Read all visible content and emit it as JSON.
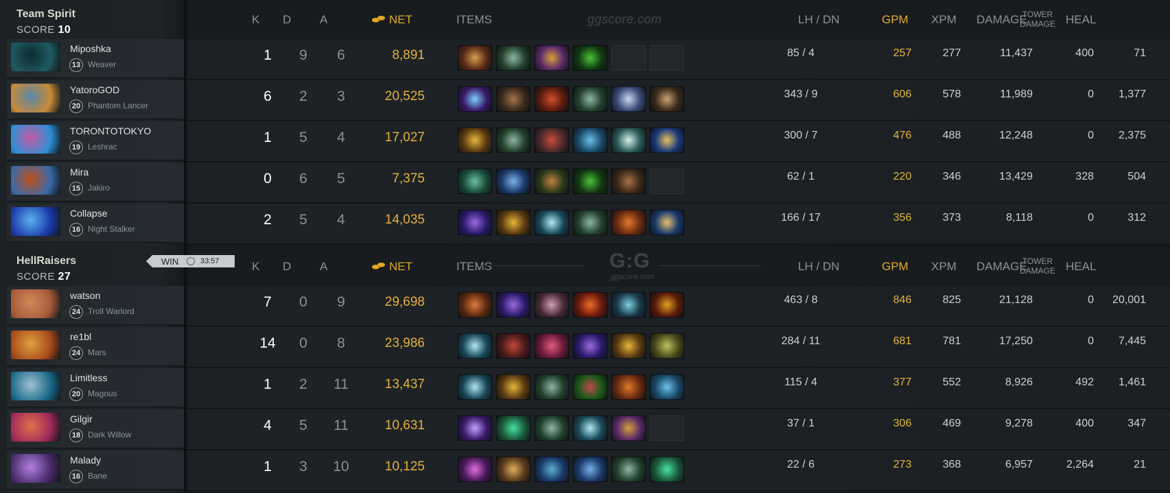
{
  "teams": [
    {
      "name": "Team Spirit",
      "score_label": "SCORE",
      "score": "10",
      "players": [
        {
          "name": "Miposhka",
          "level": "13",
          "hero": "Weaver",
          "k": "1",
          "d": "9",
          "a": "6",
          "net": "8,891",
          "lhdn": "85  /  4",
          "gpm": "257",
          "xpm": "277",
          "damage": "11,437",
          "heal": "400",
          "tower": "71",
          "portrait": [
            "#1f5a62",
            "#0d2a30"
          ],
          "items": [
            [
              "#5b2a18",
              "#d4a04a"
            ],
            [
              "#22412c",
              "#8fb5a2"
            ],
            [
              "#5a2a6a",
              "#d8a03a"
            ],
            [
              "#123a12",
              "#4cc23a"
            ],
            null,
            null
          ]
        },
        {
          "name": "YatoroGOD",
          "level": "20",
          "hero": "Phantom Lancer",
          "k": "6",
          "d": "2",
          "a": "3",
          "net": "20,525",
          "lhdn": "343  /  9",
          "gpm": "606",
          "xpm": "578",
          "damage": "11,989",
          "heal": "0",
          "tower": "1,377",
          "portrait": [
            "#c78a3a",
            "#5a88a8"
          ],
          "items": [
            [
              "#3a1a6a",
              "#7ad0ff"
            ],
            [
              "#3a2a1c",
              "#a27448"
            ],
            [
              "#5a1a10",
              "#d0502a"
            ],
            [
              "#22412c",
              "#8fb5a2"
            ],
            [
              "#3a4a7a",
              "#c9d8f0"
            ],
            [
              "#3a2a1a",
              "#c9a070"
            ]
          ]
        },
        {
          "name": "TORONTOTOKYO",
          "level": "19",
          "hero": "Leshrac",
          "k": "1",
          "d": "5",
          "a": "4",
          "net": "17,027",
          "lhdn": "300  /  7",
          "gpm": "476",
          "xpm": "488",
          "damage": "12,248",
          "heal": "0",
          "tower": "2,375",
          "portrait": [
            "#2e8fd6",
            "#c65aa2"
          ],
          "items": [
            [
              "#5a3a10",
              "#e6b53a"
            ],
            [
              "#22412c",
              "#8fb5a2"
            ],
            [
              "#4a2a2a",
              "#c94a3a"
            ],
            [
              "#1a4a6a",
              "#6ac0e8"
            ],
            [
              "#2a5a5a",
              "#d6f0e8"
            ],
            [
              "#1a3a7a",
              "#e8c060"
            ]
          ]
        },
        {
          "name": "Mira",
          "level": "15",
          "hero": "Jakiro",
          "k": "0",
          "d": "6",
          "a": "5",
          "net": "7,375",
          "lhdn": "62  /  1",
          "gpm": "220",
          "xpm": "346",
          "damage": "13,429",
          "heal": "328",
          "tower": "504",
          "portrait": [
            "#3a6aa8",
            "#c0501a"
          ],
          "items": [
            [
              "#1a4a3a",
              "#6ac0a0"
            ],
            [
              "#1a3a6a",
              "#7ab0e8"
            ],
            [
              "#2a3a1a",
              "#c08040"
            ],
            [
              "#123a12",
              "#4cc23a"
            ],
            [
              "#3a2818",
              "#a87048"
            ],
            null
          ]
        },
        {
          "name": "Collapse",
          "level": "16",
          "hero": "Night Stalker",
          "k": "2",
          "d": "5",
          "a": "4",
          "net": "14,035",
          "lhdn": "166  /  17",
          "gpm": "356",
          "xpm": "373",
          "damage": "8,118",
          "heal": "0",
          "tower": "312",
          "portrait": [
            "#1a3aa8",
            "#5ab0f0"
          ],
          "items": [
            [
              "#2a1a6a",
              "#9a6ae0"
            ],
            [
              "#5a3a10",
              "#e6b53a"
            ],
            [
              "#1a4a5a",
              "#b0e8f0"
            ],
            [
              "#22412c",
              "#8fb5a2"
            ],
            [
              "#6a2a10",
              "#e07a2a"
            ],
            [
              "#1a3a6a",
              "#e8c070"
            ]
          ]
        }
      ]
    },
    {
      "name": "HellRaisers",
      "score_label": "SCORE",
      "score": "27",
      "players": [
        {
          "name": "watson",
          "level": "24",
          "hero": "Troll Warlord",
          "k": "7",
          "d": "0",
          "a": "9",
          "net": "29,698",
          "lhdn": "463  /  8",
          "gpm": "846",
          "xpm": "825",
          "damage": "21,128",
          "heal": "0",
          "tower": "20,001",
          "portrait": [
            "#a85a3a",
            "#d08a5a"
          ],
          "items": [
            [
              "#5a2a10",
              "#e07a3a"
            ],
            [
              "#2a1a6a",
              "#9a6ae0"
            ],
            [
              "#4a2a3a",
              "#d0a0b0"
            ],
            [
              "#6a1a0a",
              "#f06a2a"
            ],
            [
              "#1a3a4a",
              "#7ad0e0"
            ],
            [
              "#5a1a0a",
              "#e0a020"
            ]
          ]
        },
        {
          "name": "re1bl",
          "level": "24",
          "hero": "Mars",
          "k": "14",
          "d": "0",
          "a": "8",
          "net": "23,986",
          "lhdn": "284  /  11",
          "gpm": "681",
          "xpm": "781",
          "damage": "17,250",
          "heal": "0",
          "tower": "7,445",
          "portrait": [
            "#a84a1a",
            "#e0a040"
          ],
          "items": [
            [
              "#1a4a5a",
              "#b0e8f0"
            ],
            [
              "#4a1a1a",
              "#c04a3a"
            ],
            [
              "#6a1a3a",
              "#e05a7a"
            ],
            [
              "#2a1a6a",
              "#9a6ae0"
            ],
            [
              "#5a3a10",
              "#e6b53a"
            ],
            [
              "#4a4a1a",
              "#c0c060"
            ]
          ]
        },
        {
          "name": "Limitless",
          "level": "20",
          "hero": "Magnus",
          "k": "1",
          "d": "2",
          "a": "11",
          "net": "13,437",
          "lhdn": "115  /  4",
          "gpm": "377",
          "xpm": "552",
          "damage": "8,926",
          "heal": "492",
          "tower": "1,461",
          "portrait": [
            "#1a6a8a",
            "#a0c0d0"
          ],
          "items": [
            [
              "#1a4a5a",
              "#b0e8f0"
            ],
            [
              "#5a3a10",
              "#e6b53a"
            ],
            [
              "#22412c",
              "#8fb5a2"
            ],
            [
              "#1a5a1a",
              "#c04a4a"
            ],
            [
              "#6a2a10",
              "#e07a2a"
            ],
            [
              "#1a4a6a",
              "#6ac0e8"
            ]
          ]
        },
        {
          "name": "Gilgir",
          "level": "18",
          "hero": "Dark Willow",
          "k": "4",
          "d": "5",
          "a": "11",
          "net": "10,631",
          "lhdn": "37  /  1",
          "gpm": "306",
          "xpm": "469",
          "damage": "9,278",
          "heal": "400",
          "tower": "347",
          "portrait": [
            "#a02a5a",
            "#e0704a"
          ],
          "items": [
            [
              "#3a1a6a",
              "#c0a0ff"
            ],
            [
              "#1a5a3a",
              "#4ae0a0"
            ],
            [
              "#22412c",
              "#8fb5a2"
            ],
            [
              "#1a4a5a",
              "#b0e8f0"
            ],
            [
              "#5a2a6a",
              "#d8a03a"
            ],
            null
          ]
        },
        {
          "name": "Malady",
          "level": "16",
          "hero": "Bane",
          "k": "1",
          "d": "3",
          "a": "10",
          "net": "10,125",
          "lhdn": "22  /  6",
          "gpm": "273",
          "xpm": "368",
          "damage": "6,957",
          "heal": "2,264",
          "tower": "21",
          "portrait": [
            "#4a2a6a",
            "#b080e0"
          ],
          "items": [
            [
              "#4a1a5a",
              "#e06ae0"
            ],
            [
              "#5a3a1a",
              "#e0b060"
            ],
            [
              "#1a3a6a",
              "#5ab0d0"
            ],
            [
              "#1a3a6a",
              "#7ab0e8"
            ],
            [
              "#22412c",
              "#8fb5a2"
            ],
            [
              "#1a5a3a",
              "#4ae0a0"
            ]
          ]
        }
      ]
    }
  ],
  "result": {
    "label": "WIN",
    "time": "33:57"
  },
  "columns": {
    "k": "K",
    "d": "D",
    "a": "A",
    "net": "NET",
    "items": "ITEMS",
    "lhdn": "LH  /  DN",
    "gpm": "GPM",
    "xpm": "XPM",
    "damage": "DAMAGE",
    "heal": "HEAL",
    "tower_line1": "TOWER",
    "tower_line2": "DAMAGE"
  },
  "watermark": "ggscore.com",
  "logo": {
    "mark": "G:G",
    "sub": "ggscore.com"
  },
  "icons": {
    "gold": "gold-coins-icon",
    "clock": "clock-icon",
    "item": "item-icon",
    "hero": "hero-portrait"
  },
  "colors": {
    "gold": "#e2a92a",
    "background": "#15191c",
    "win_tag": "#c7ccd0"
  }
}
